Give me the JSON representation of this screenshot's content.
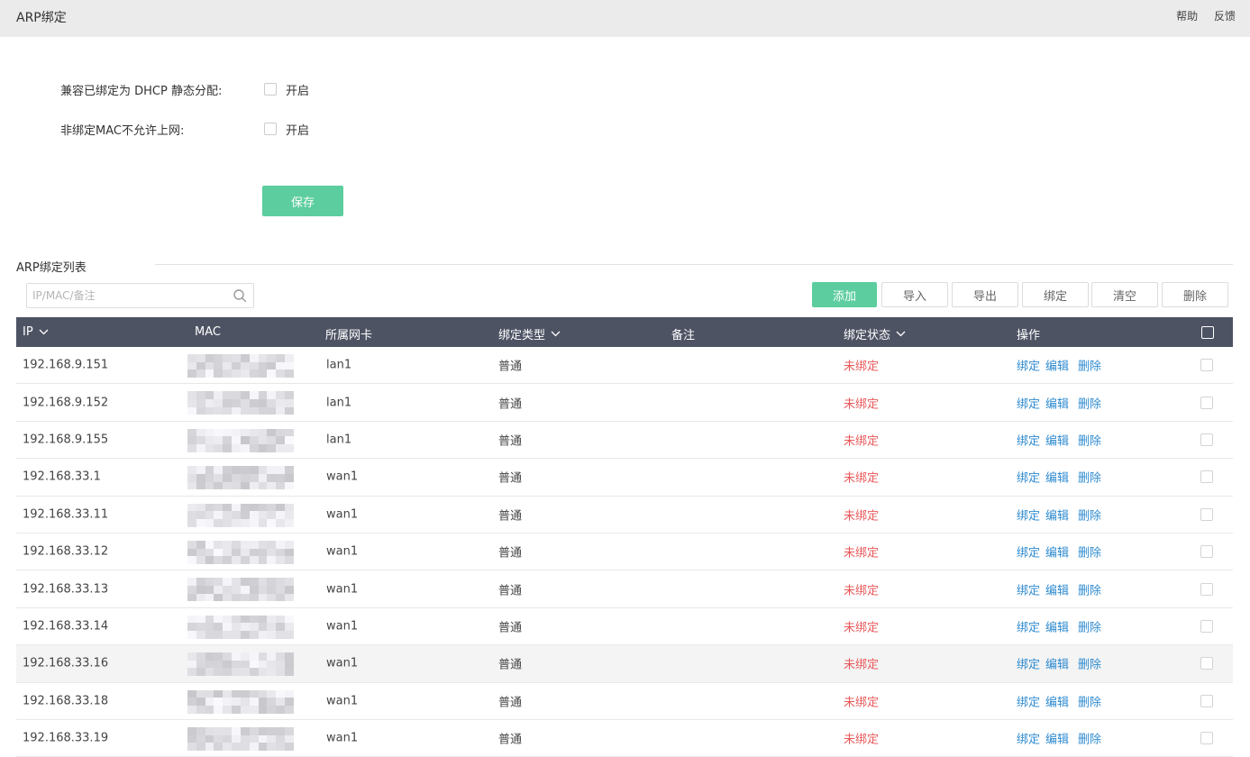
{
  "header": {
    "title": "ARP绑定",
    "help": "帮助",
    "feedback": "反馈"
  },
  "settings": {
    "compat_label": "兼容已绑定为 DHCP 静态分配:",
    "compat_option": "开启",
    "nonbind_label": "非绑定MAC不允许上网:",
    "nonbind_option": "开启",
    "save": "保存"
  },
  "list": {
    "title": "ARP绑定列表",
    "search_placeholder": "IP/MAC/备注",
    "buttons": {
      "add": "添加",
      "import": "导入",
      "export": "导出",
      "bind": "绑定",
      "clear": "清空",
      "delete": "删除"
    },
    "columns": {
      "ip": "IP",
      "mac": "MAC",
      "nic": "所属网卡",
      "type": "绑定类型",
      "remark": "备注",
      "status": "绑定状态",
      "ops": "操作"
    },
    "ops": {
      "bind": "绑定",
      "edit": "编辑",
      "delete": "删除"
    },
    "rows": [
      {
        "ip": "192.168.9.151",
        "nic": "lan1",
        "type": "普通",
        "status": "未绑定"
      },
      {
        "ip": "192.168.9.152",
        "nic": "lan1",
        "type": "普通",
        "status": "未绑定"
      },
      {
        "ip": "192.168.9.155",
        "nic": "lan1",
        "type": "普通",
        "status": "未绑定"
      },
      {
        "ip": "192.168.33.1",
        "nic": "wan1",
        "type": "普通",
        "status": "未绑定"
      },
      {
        "ip": "192.168.33.11",
        "nic": "wan1",
        "type": "普通",
        "status": "未绑定"
      },
      {
        "ip": "192.168.33.12",
        "nic": "wan1",
        "type": "普通",
        "status": "未绑定"
      },
      {
        "ip": "192.168.33.13",
        "nic": "wan1",
        "type": "普通",
        "status": "未绑定"
      },
      {
        "ip": "192.168.33.14",
        "nic": "wan1",
        "type": "普通",
        "status": "未绑定"
      },
      {
        "ip": "192.168.33.16",
        "nic": "wan1",
        "type": "普通",
        "status": "未绑定",
        "highlight": true
      },
      {
        "ip": "192.168.33.18",
        "nic": "wan1",
        "type": "普通",
        "status": "未绑定"
      },
      {
        "ip": "192.168.33.19",
        "nic": "wan1",
        "type": "普通",
        "status": "未绑定"
      }
    ]
  },
  "colors": {
    "primary": "#5ccd9e",
    "header_bg": "#4e5364",
    "status_red": "#e8585a",
    "link_blue": "#2f8bd0"
  }
}
